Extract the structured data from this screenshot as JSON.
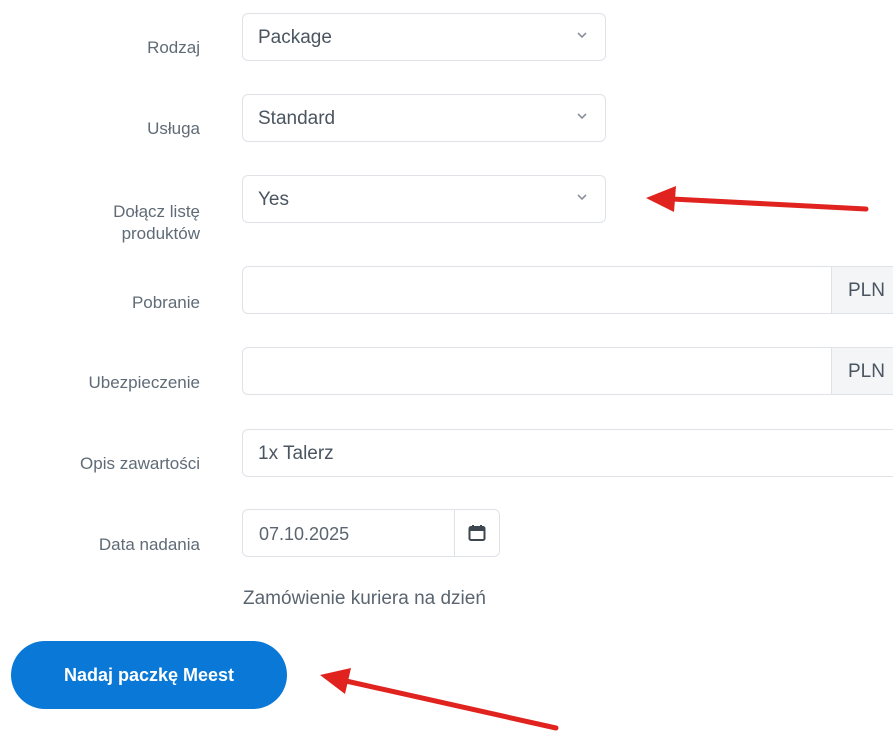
{
  "form": {
    "rodzaj": {
      "label": "Rodzaj",
      "value": "Package"
    },
    "usluga": {
      "label": "Usługa",
      "value": "Standard"
    },
    "dolacz": {
      "label_line1": "Dołącz listę",
      "label_line2": "produktów",
      "value": "Yes"
    },
    "pobranie": {
      "label": "Pobranie",
      "value": "",
      "addon": "PLN"
    },
    "ubezpieczenie": {
      "label": "Ubezpieczenie",
      "value": "",
      "addon": "PLN"
    },
    "opis": {
      "label": "Opis zawartości",
      "value": "1x Talerz"
    },
    "data": {
      "label": "Data nadania",
      "value": "07.10.2025",
      "helper": "Zamówienie kuriera na dzień"
    },
    "submit_label": "Nadaj paczkę Meest"
  },
  "colors": {
    "accent": "#0a78d6",
    "arrow": "#e0231f"
  }
}
